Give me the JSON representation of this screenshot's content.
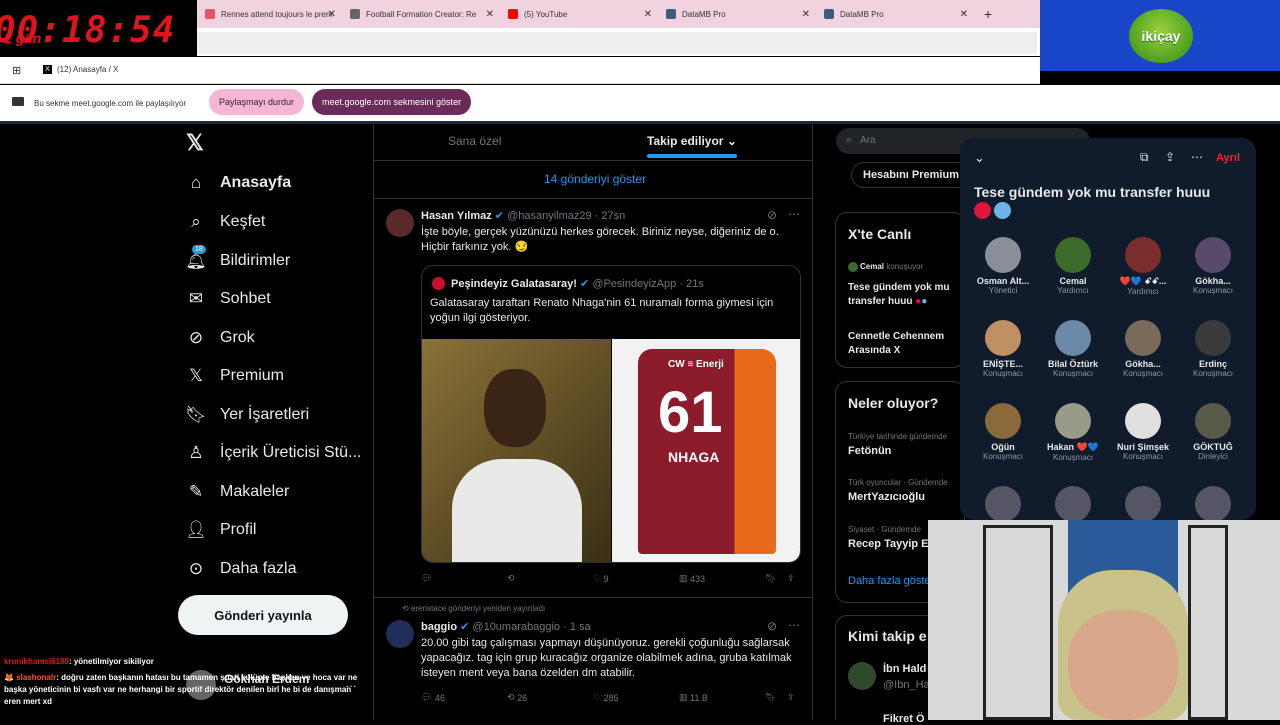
{
  "timer": {
    "days": "2",
    "days_label": "gün",
    "clock": "00:18:54"
  },
  "browser_tabs": [
    {
      "title": "Rennes attend toujours le prem",
      "color": "#e8546a"
    },
    {
      "title": "Football Formation Creator: Re",
      "color": "#666666"
    },
    {
      "title": "(5) YouTube",
      "color": "#ff0000"
    },
    {
      "title": "DataMB Pro",
      "color": "#3d5a80"
    },
    {
      "title": "DataMB Pro",
      "color": "#3d5a80"
    }
  ],
  "new_tab": "+",
  "window_title": "(12) Anasayfa / X",
  "share_bar": {
    "text": "Bu sekme meet.google.com ile paylaşılıyor",
    "stop_button": "Paylaşmayı durdur",
    "show_button": "meet.google.com sekmesini göster"
  },
  "brand_logo": "ikiçay",
  "sidebar": {
    "items": [
      {
        "label": "Anasayfa",
        "icon": "home-icon",
        "active": true
      },
      {
        "label": "Keşfet",
        "icon": "search-icon"
      },
      {
        "label": "Bildirimler",
        "icon": "bell-icon",
        "badge": "18"
      },
      {
        "label": "Sohbet",
        "icon": "mail-icon"
      },
      {
        "label": "Grok",
        "icon": "grok-icon"
      },
      {
        "label": "Premium",
        "icon": "x-logo-icon"
      },
      {
        "label": "Yer İşaretleri",
        "icon": "bookmark-icon"
      },
      {
        "label": "İçerik Üreticisi Stü...",
        "icon": "creator-icon"
      },
      {
        "label": "Makaleler",
        "icon": "article-icon"
      },
      {
        "label": "Profil",
        "icon": "profile-icon"
      },
      {
        "label": "Daha fazla",
        "icon": "more-icon"
      }
    ],
    "post_button": "Gönderi yayınla",
    "account_name": "Gökhan Erdem"
  },
  "feed": {
    "tabs": [
      "Sana özel",
      "Takip ediliyor"
    ],
    "show_new": "14 gönderiyi göster",
    "tweet1": {
      "name": "Hasan Yılmaz",
      "handle": "@hasanyilmaz29",
      "time": "27sn",
      "text": "İşte böyle, gerçek yüzünüzü herkes görecek. Biriniz neyse, diğeriniz de o. Hiçbir farkınız yok. 😏",
      "quote": {
        "name": "Peşindeyiz Galatasaray!",
        "handle": "@PesindeyizApp",
        "time": "21s",
        "text": "Galatasaray taraftarı Renato Nhaga'nin 61 nuramalı forma giymesi için yoğun ilgi gösteriyor.",
        "jersey_sponsor": "CW ≡ Enerji",
        "jersey_number": "61",
        "jersey_name": "NHAGA"
      },
      "likes": "9",
      "views": "433"
    },
    "repost_note": "erenstace gönderiyi yeniden yayınladı",
    "tweet2": {
      "name": "baggio",
      "handle": "@10umarabaggio",
      "time": "1 sa",
      "text": "20.00 gibi tag çalışması yapmayı düşünüyoruz. gerekli çoğunluğu sağlarsak yapacağız. tag için grup kuracağız organize olabilmek adına, gruba katılmak isteyen ment veya bana özelden dm atabilir.",
      "replies": "46",
      "reposts": "26",
      "likes": "285",
      "views": "11 B"
    }
  },
  "right": {
    "search_placeholder": "Ara",
    "premium_button": "Hesabını Premium",
    "live_title": "X'te Canlı",
    "live_host": "Cemal",
    "live_status": "konuşuyor",
    "live_topic": "Tese gündem yok mu transfer huuu",
    "live_topic2": "Cennetle Cehennem Arasında X",
    "trends_title": "Neler oluyor?",
    "trends": [
      {
        "meta": "Türkiye tarihinde gündemde",
        "name": "Fetönün"
      },
      {
        "meta": "Türk oyuncular · Gündemde",
        "name": "MertYazıcıoğlu"
      },
      {
        "meta": "Siyaset · Gündemde",
        "name": "Recep Tayyip E"
      }
    ],
    "show_more": "Daha fazla göste",
    "follow_title": "Kimi takip e",
    "follow_name": "İbn Hald",
    "follow_handle": "@Ibn_Ha",
    "follow_name2": "Fikret Ö"
  },
  "space": {
    "leave": "Ayrıl",
    "title": "Tese gündem yok mu transfer huuu",
    "speakers": [
      {
        "name": "Osman Alt...",
        "role": "Yönetici",
        "color": "#8a8f99"
      },
      {
        "name": "Cemal",
        "role": "Yardımcı",
        "color": "#3b6a2a"
      },
      {
        "name": "❤️💙 ꗃꗃ...",
        "role": "Yardımcı",
        "color": "#7a2d2d"
      },
      {
        "name": "Gökha...",
        "role": "Konuşmacı",
        "color": "#5a4a6a"
      },
      {
        "name": "ENİŞTE...",
        "role": "Konuşmacı",
        "color": "#c09060"
      },
      {
        "name": "Bilal Öztürk",
        "role": "Konuşmacı",
        "color": "#6a8aa8"
      },
      {
        "name": "Gökha...",
        "role": "Konuşmacı",
        "color": "#7a6a5a"
      },
      {
        "name": "Erdinç",
        "role": "Konuşmacı",
        "color": "#3a3a3a"
      },
      {
        "name": "Oğün",
        "role": "Konuşmacı",
        "color": "#8a6a3a"
      },
      {
        "name": "Hakan ❤️💙",
        "role": "Konuşmacı",
        "color": "#9a9a8a"
      },
      {
        "name": "Nuri Şimşek",
        "role": "Konuşmacı",
        "color": "#e0e0e0"
      },
      {
        "name": "GÖKTUĞ",
        "role": "Dinleyici",
        "color": "#5a5a4a"
      }
    ]
  },
  "chat": [
    {
      "user": "kronikhamsi6198",
      "user_color": "#e0141e",
      "text": ": yönetilmiyor sikiliyor"
    },
    {
      "user": "slashonalr",
      "user_color": "#ff5a1f",
      "text": ": doğru zaten başkanın hatası bu tamamen şuan kulüpte başkan ve hoca var ne başka yöneticinin bi vasfı var ne herhangi bir sportif direktör denilen birl he bi de danışman eren mert xd"
    }
  ]
}
